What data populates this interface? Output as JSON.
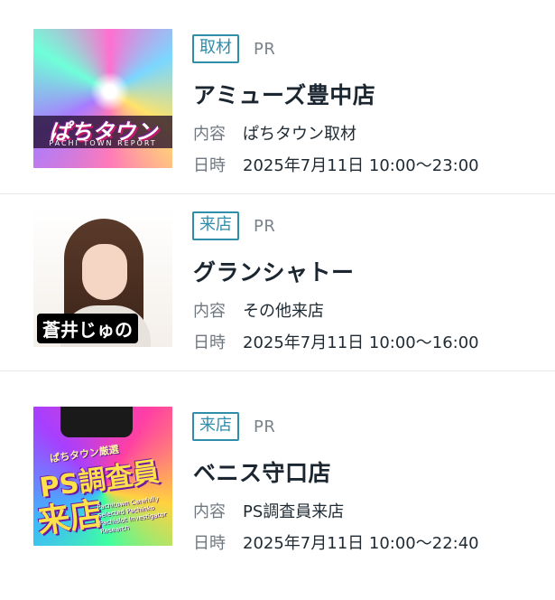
{
  "items": [
    {
      "tag": "取材",
      "pr": "PR",
      "shop_name": "アミューズ豊中店",
      "content_label": "内容",
      "content_value": "ぱちタウン取材",
      "datetime_label": "日時",
      "datetime_value": "2025年7月11日 10:00〜23:00",
      "thumb_logo": "ぱちタウン",
      "thumb_sub": "PACHI TOWN REPORT"
    },
    {
      "tag": "来店",
      "pr": "PR",
      "shop_name": "グランシャトー",
      "content_label": "内容",
      "content_value": "その他来店",
      "datetime_label": "日時",
      "datetime_value": "2025年7月11日 10:00〜16:00",
      "thumb_name": "蒼井じゅの"
    },
    {
      "tag": "来店",
      "pr": "PR",
      "shop_name": "ベニス守口店",
      "content_label": "内容",
      "content_value": "PS調査員来店",
      "datetime_label": "日時",
      "datetime_value": "2025年7月11日 10:00〜22:40",
      "thumb_small": "ぱちタウン厳選",
      "thumb_big": "PS調査員",
      "thumb_big2": "来店",
      "thumb_en": "Pachitown Carefully selected Pachinko Pachislot Investigator Research"
    }
  ],
  "colors": {
    "tag_border": "#2f8eaa",
    "tag_text": "#2f8eaa",
    "label_text": "#6f7780",
    "title_text": "#1b2630",
    "divider": "#e6e8ea"
  }
}
